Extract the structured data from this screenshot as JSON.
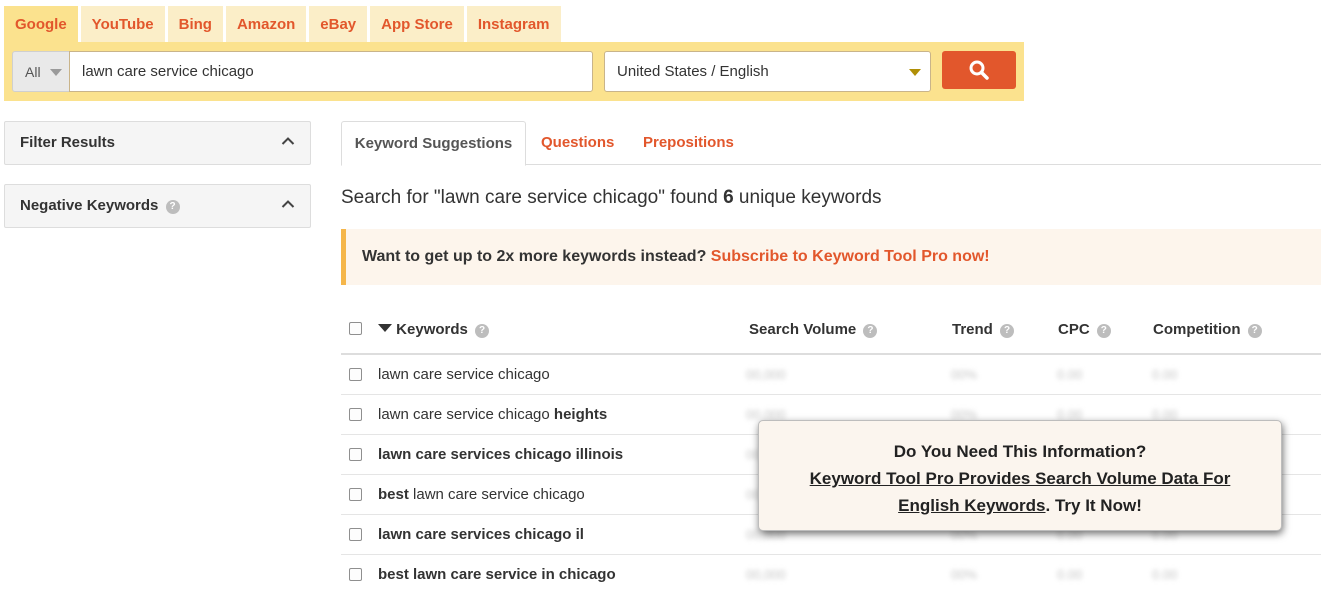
{
  "engine_tabs": [
    "Google",
    "YouTube",
    "Bing",
    "Amazon",
    "eBay",
    "App Store",
    "Instagram"
  ],
  "search": {
    "scope_label": "All",
    "query": "lawn care service chicago",
    "location_language": "United States / English"
  },
  "sidebar": {
    "filter_results": "Filter Results",
    "negative_keywords": "Negative Keywords"
  },
  "result_tabs": {
    "keyword_suggestions": "Keyword Suggestions",
    "questions": "Questions",
    "prepositions": "Prepositions"
  },
  "found": {
    "prefix": "Search for \"lawn care service chicago\" found ",
    "count": "6",
    "suffix": " unique keywords"
  },
  "promo": {
    "text": "Want to get up to 2x more keywords instead? ",
    "link": "Subscribe to Keyword Tool Pro now!"
  },
  "table": {
    "headers": {
      "keywords": "Keywords",
      "search_volume": "Search Volume",
      "trend": "Trend",
      "cpc": "CPC",
      "competition": "Competition"
    },
    "rows": [
      {
        "pre": "",
        "base": "lawn care service chicago",
        "post": ""
      },
      {
        "pre": "",
        "base": "lawn care service chicago ",
        "post": "heights"
      },
      {
        "pre": "lawn care services chicago illinois",
        "base": "",
        "post": ""
      },
      {
        "pre": "best ",
        "base": "lawn care service chicago",
        "post": ""
      },
      {
        "pre": "lawn care services chicago il",
        "base": "",
        "post": ""
      },
      {
        "pre": "best lawn care service in chicago",
        "base": "",
        "post": ""
      }
    ],
    "masked": {
      "volume": "00,000",
      "trend": "00%",
      "cpc": "0.00",
      "competition": "0.00"
    }
  },
  "popup": {
    "line1": "Do You Need This Information?",
    "link_a": "Keyword Tool Pro Provides Search Volume Data For",
    "link_b": "English Keywords",
    "tail": ". Try It Now!"
  },
  "colors": {
    "accent": "#e2572c",
    "panel": "#fbe28e",
    "promo_border": "#f5b64a"
  }
}
